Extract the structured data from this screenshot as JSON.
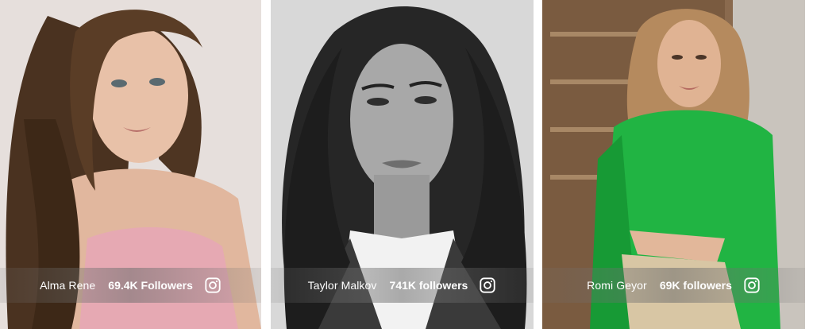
{
  "cards": [
    {
      "name": "Alma Rene",
      "followers": "69.4K Followers",
      "icon": "instagram-icon"
    },
    {
      "name": "Taylor Malkov",
      "followers": "741K followers",
      "icon": "instagram-icon"
    },
    {
      "name": "Romi Geyor",
      "followers": "69K followers",
      "icon": "instagram-icon"
    }
  ],
  "colors": {
    "caption_text": "#ffffff",
    "card1_tone": "#d9b8a4",
    "card2_tone": "#3a3a3a",
    "card3_accent": "#1fae3e"
  }
}
